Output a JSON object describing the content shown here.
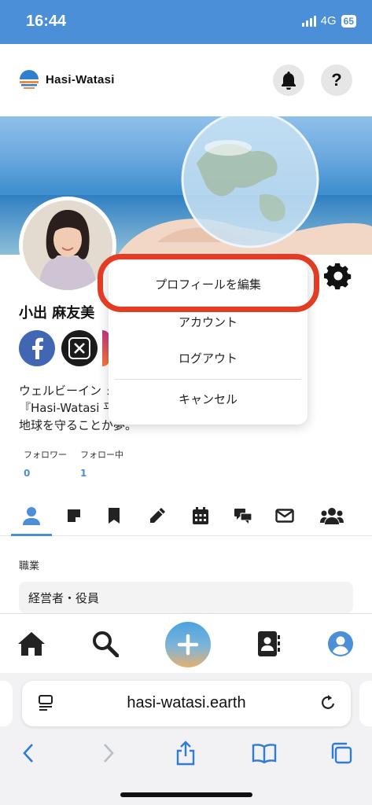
{
  "status_bar": {
    "time": "16:44",
    "network": "4G",
    "battery": "65"
  },
  "header": {
    "title": "Hasi-Watasi",
    "help_label": "?"
  },
  "profile": {
    "name": "小出 麻友美",
    "bio_lines": [
      "ウェルビーイン                                              ォーム",
      "『Hasi-Watasi                                               平和と",
      "地球を守ることが夢。"
    ],
    "followers_label": "フォロワー",
    "followers_count": "0",
    "following_label": "フォロー中",
    "following_count": "1"
  },
  "dropdown": {
    "items": [
      "プロフィールを編集",
      "アカウント",
      "ログアウト",
      "キャンセル"
    ]
  },
  "details": {
    "label": "職業",
    "value": "経営者・役員"
  },
  "browser": {
    "url": "hasi-watasi.earth"
  },
  "colors": {
    "accent": "#4a8fd8",
    "highlight": "#e33b24"
  },
  "icons": [
    "bell-icon",
    "help-icon",
    "gear-icon",
    "facebook-icon",
    "x-icon",
    "person-icon",
    "note-icon",
    "bookmark-icon",
    "pencil-icon",
    "calendar-icon",
    "chat-icon",
    "mail-icon",
    "group-icon",
    "home-icon",
    "search-icon",
    "plus-icon",
    "contacts-icon",
    "account-icon"
  ]
}
